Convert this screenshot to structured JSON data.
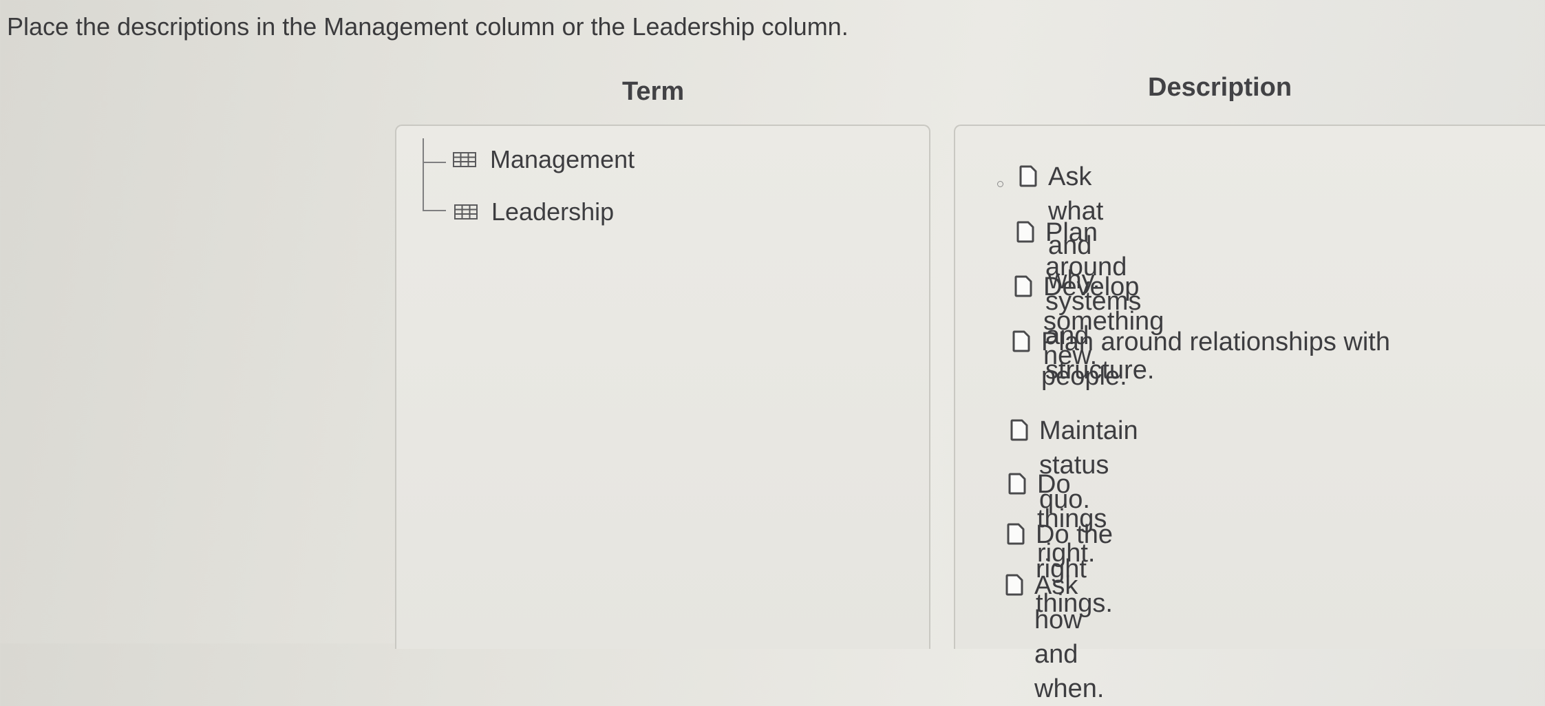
{
  "instruction": "Place the descriptions in the Management column or the Leadership column.",
  "columns": {
    "term_header": "Term",
    "description_header": "Description"
  },
  "terms": [
    {
      "label": "Management",
      "icon": "table-icon"
    },
    {
      "label": "Leadership",
      "icon": "table-icon"
    }
  ],
  "descriptions": [
    {
      "text": "Ask what and why.",
      "icon": "document-icon"
    },
    {
      "text": "Plan around systems and structure.",
      "icon": "document-icon"
    },
    {
      "text": "Develop something new.",
      "icon": "document-icon"
    },
    {
      "text": "Plan around relationships with people.",
      "icon": "document-icon"
    },
    {
      "text": "Maintain status quo.",
      "icon": "document-icon"
    },
    {
      "text": "Do things right.",
      "icon": "document-icon"
    },
    {
      "text": "Do the right things.",
      "icon": "document-icon"
    },
    {
      "text": "Ask how and when.",
      "icon": "document-icon"
    }
  ]
}
